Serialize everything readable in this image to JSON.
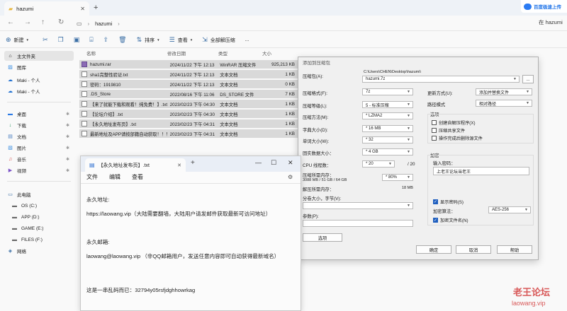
{
  "explorer": {
    "tab_title": "hazumi",
    "crumb_folder": "hazumi",
    "search_text": "在 hazumi",
    "toolbar": {
      "new": "新建",
      "sort": "排序",
      "view": "查看",
      "extract_all": "全部解压缩",
      "more": "..."
    },
    "sidebar": {
      "home": "主文件夹",
      "gallery": "图库",
      "maki1": "Maki - 个人",
      "maki2": "Maki - 个人",
      "desktop": "桌面",
      "downloads": "下载",
      "documents": "文档",
      "pictures": "图片",
      "music": "音乐",
      "videos": "视频",
      "this_pc": "此电脑",
      "os": "OS (C:)",
      "app": "APP (D:)",
      "game": "GAME (E:)",
      "files": "FILES (F:)",
      "network": "网络"
    },
    "columns": {
      "name": "名称",
      "date": "修改日期",
      "type": "类型",
      "size": "大小"
    },
    "files": [
      {
        "name": "hazumi.rar",
        "date": "2024/11/22 下午 12:13",
        "type": "WinRAR 压缩文件",
        "size": "925,213 KB"
      },
      {
        "name": "sha1完整性验证.txt",
        "date": "2024/11/22 下午 12:13",
        "type": "文本文档",
        "size": "1 KB"
      },
      {
        "name": "密码：1919810",
        "date": "2024/11/22 下午 12:13",
        "type": "文本文档",
        "size": "0 KB"
      },
      {
        "name": ".DS_Store",
        "date": "2022/08/16 下午 11:06",
        "type": "DS_STORE 文件",
        "size": "7 KB"
      },
      {
        "name": "【来了就能下载和观看！纯免费！】.txt",
        "date": "2023/02/23 下午 04:30",
        "type": "文本文档",
        "size": "1 KB"
      },
      {
        "name": "【论坛介绍】.txt",
        "date": "2023/02/23 下午 04:30",
        "type": "文本文档",
        "size": "1 KB"
      },
      {
        "name": "【永久地址发布页】.txt",
        "date": "2023/02/23 下午 04:31",
        "type": "文本文档",
        "size": "1 KB"
      },
      {
        "name": "最新地址及APP请按部籍自动获取！！！...",
        "date": "2023/02/23 下午 04:31",
        "type": "文本文档",
        "size": "1 KB"
      }
    ]
  },
  "notepad": {
    "tab_title": "【永久地址发布页】.txt",
    "menu": {
      "file": "文件",
      "edit": "编辑",
      "view": "查看"
    },
    "lines": [
      "永久地址:",
      "https://laowang.vip（大陆需要翻墙，大陆用户请发邮件获取最新可访问地址）",
      "永久邮箱:",
      "laowang@laowang.vip （非QQ邮箱用户，发送任意内容即可自动获得最新域名）",
      "这是一串乱码而已：32794y05rsfjdghhowrkag"
    ]
  },
  "dialog": {
    "title": "添加到压缩包",
    "archive_name_label": "压缩包(A):",
    "archive_path": "C:\\Users\\CHEN\\Desktop\\hazumi\\",
    "archive_name": "hazumi.7z",
    "browse": "...",
    "format_label": "压缩格式(F):",
    "format": "7z",
    "level_label": "压缩等级(L):",
    "level": "5 - 标准压缩",
    "method_label": "压缩方法(M):",
    "method": "* LZMA2",
    "dict_label": "字典大小(D):",
    "dict": "* 16 MB",
    "word_label": "单词大小(W):",
    "word": "* 32",
    "solid_label": "固实数据大小：",
    "solid": "* 4 GB",
    "threads_label": "CPU 线程数：",
    "threads": "* 20",
    "threads_max": "/ 20",
    "mem_label": "压缩所需内存：",
    "mem_detail": "3088 MB / 51 GB / 64 GB",
    "mem_pct": "* 80%",
    "decomp_label": "解压所需内存：",
    "decomp_value": "18 MB",
    "split_label": "分卷大小，字节(V):",
    "params_label": "参数(P):",
    "options_btn": "选项",
    "update_label": "更新方式(U):",
    "update": "添加并替换文件",
    "pathmode_label": "路径模式",
    "pathmode": "相对路径",
    "options_group": "选项",
    "opt_sfx": "创建自解压程序(X)",
    "opt_shared": "压缩共享文件",
    "opt_delete": "操作完成后删除源文件",
    "encrypt_group": "加密",
    "pwd_label": "输入密码：",
    "pwd": "上老王论坛当老王",
    "show_pwd": "显示密码(S)",
    "enc_method_label": "加密算法：",
    "enc_method": "AES-256",
    "enc_names": "加密文件名(N)",
    "ok": "确定",
    "cancel": "取消",
    "help": "帮助"
  },
  "watermark": {
    "baidu": "百度极速上传",
    "logo": "老王论坛",
    "url": "laowang.vip"
  },
  "colors": {
    "accent": "#1f5fbf",
    "selection": "#d9d9d9",
    "watermark": "#d23c3c"
  }
}
